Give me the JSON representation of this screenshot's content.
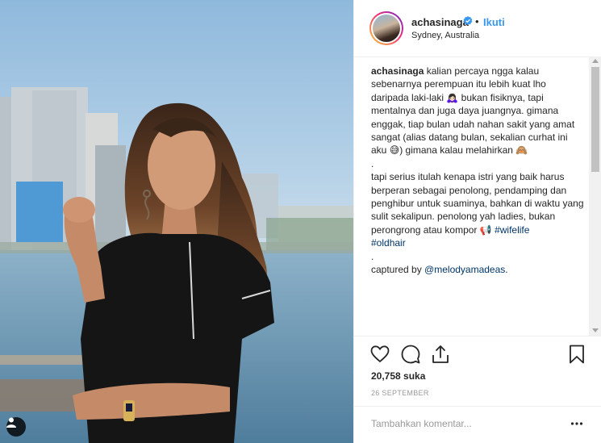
{
  "post": {
    "username": "achasinaga",
    "dot": "•",
    "follow_label": "Ikuti",
    "location": "Sydney, Australia"
  },
  "caption": {
    "author": "achasinaga",
    "part1": " kalian percaya ngga kalau sebenarnya perempuan itu lebih kuat lho daripada laki-laki ",
    "emoji1": "🙇🏻‍♀️",
    "part2": " bukan fisiknya, tapi mentalnya dan juga daya juangnya. gimana enggak, tiap bulan udah nahan sakit yang amat sangat (alias datang bulan, sekalian curhat ini aku ",
    "emoji2": "😅",
    "part3": ") gimana kalau melahirkan ",
    "emoji3": "🙈",
    "period1": ".",
    "paragraph2": "tapi serius itulah kenapa istri yang baik harus berperan sebagai penolong, pendamping dan penghibur untuk suaminya, bahkan di waktu yang sulit sekalipun. penolong yah ladies, bukan perongrong atau kompor ",
    "emoji4": "📢",
    "hashtag1": "#wifelife",
    "hashtag2": "#oldhair",
    "period2": ".",
    "captured_prefix": "captured by ",
    "captured_mention": "@melodyamadeas",
    "captured_suffix": "."
  },
  "engagement": {
    "likes": "20,758 suka",
    "date": "26 SEPTEMBER"
  },
  "comment": {
    "placeholder": "Tambahkan komentar..."
  },
  "icons": {
    "user_tag": "user-tag-icon",
    "verified": "verified-badge-icon",
    "like": "heart-icon",
    "comment": "comment-icon",
    "share": "share-icon",
    "save": "bookmark-icon",
    "more": "more-options-icon"
  },
  "colors": {
    "follow_blue": "#3897f0",
    "link_blue": "#003569",
    "verified_blue": "#3897f0",
    "text": "#262626",
    "muted": "#999999"
  }
}
